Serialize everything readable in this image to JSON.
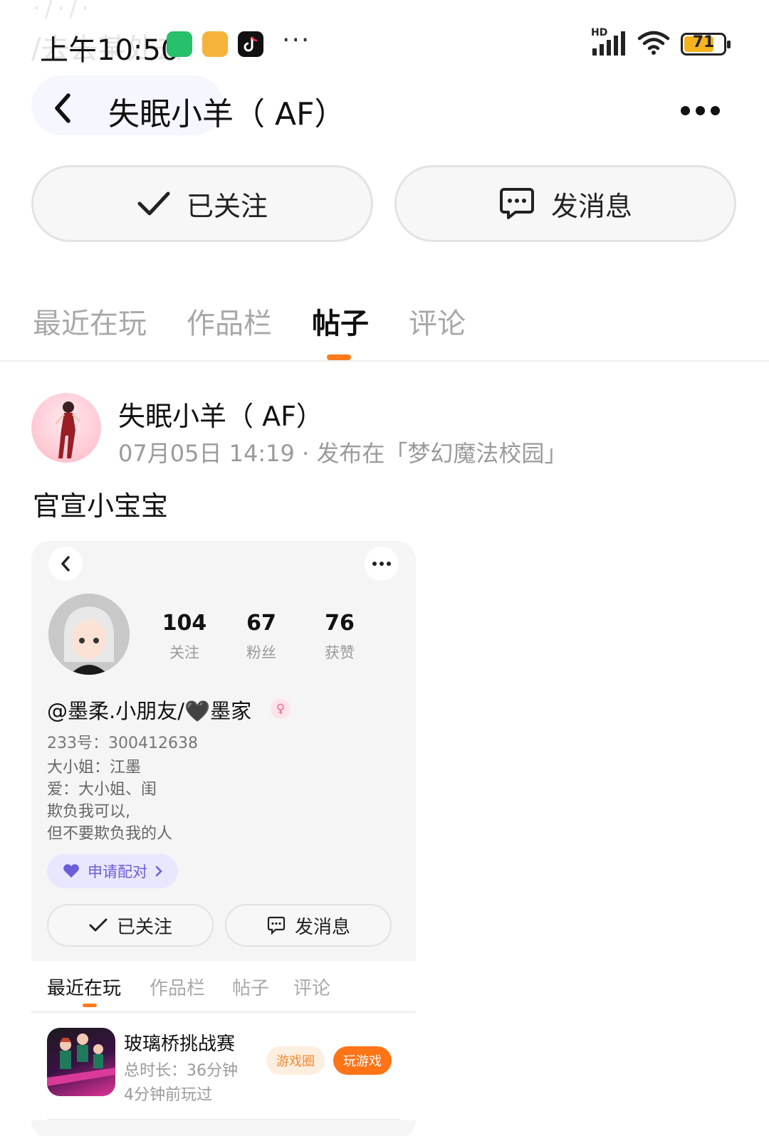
{
  "status_bar": {
    "time": "上午10:50",
    "ghost_text": "/去去某处去",
    "ghost_top": "·/·/·",
    "more": "···",
    "network": "HD",
    "battery": "71",
    "battery_level": 0.71
  },
  "nav": {
    "title": "失眠小羊（ AF）"
  },
  "actions": {
    "follow_label": "已关注",
    "message_label": "发消息"
  },
  "tabs": [
    {
      "label": "最近在玩"
    },
    {
      "label": "作品栏"
    },
    {
      "label": "帖子"
    },
    {
      "label": "评论"
    }
  ],
  "active_tab": "帖子",
  "post": {
    "author": "失眠小羊（ AF）",
    "meta": "07月05日 14:19 · 发布在「梦幻魔法校园」",
    "text": "官宣小宝宝"
  },
  "embed": {
    "stats": [
      {
        "num": "104",
        "label": "关注"
      },
      {
        "num": "67",
        "label": "粉丝"
      },
      {
        "num": "76",
        "label": "获赞"
      }
    ],
    "name": "@墨柔.小朋友/🖤墨家",
    "gender_symbol": "♀",
    "id_line": "233号：300412638",
    "bio": [
      "大小姐：江墨",
      "爱：大小姐、闺",
      "欺负我可以,",
      "但不要欺负我的人"
    ],
    "pair_label": "申请配对",
    "follow_label": "已关注",
    "message_label": "发消息",
    "tabs": [
      "最近在玩",
      "作品栏",
      "帖子",
      "评论"
    ],
    "game": {
      "title": "玻璃桥挑战赛",
      "duration": "总时长：36分钟",
      "last_played": "4分钟前玩过",
      "circle_label": "游戏圈",
      "play_label": "玩游戏"
    }
  },
  "colors": {
    "accent": "#ff7a1a",
    "pair": "#6a5fd8",
    "battery": "#f5b31e"
  }
}
